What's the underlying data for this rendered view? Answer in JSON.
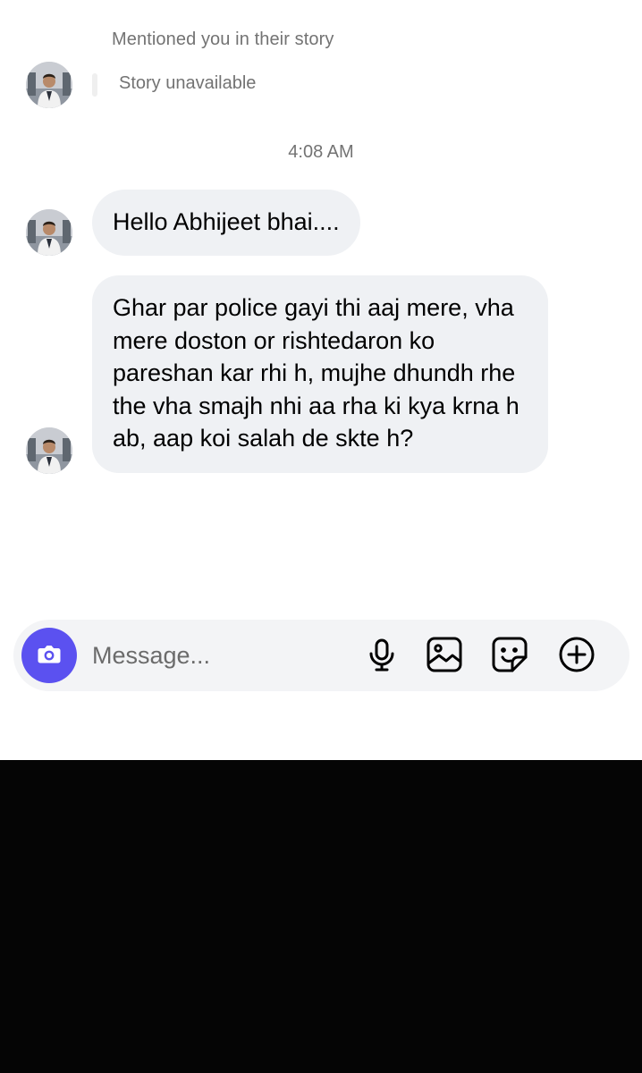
{
  "story": {
    "mention_text": "Mentioned you in their story",
    "unavailable_text": "Story unavailable"
  },
  "thread": {
    "timestamp": "4:08 AM",
    "messages": [
      {
        "text": "Hello Abhijeet bhai...."
      },
      {
        "text": "Ghar par police gayi thi aaj mere, vha mere doston or rishtedaron ko pareshan kar rhi h, mujhe dhundh rhe the vha smajh nhi aa rha ki kya krna h ab, aap koi salah de skte h?"
      }
    ]
  },
  "composer": {
    "placeholder": "Message...",
    "value": "",
    "icons": {
      "camera": "camera-icon",
      "mic": "microphone-icon",
      "gallery": "gallery-icon",
      "sticker": "sticker-icon",
      "more": "plus-circle-icon"
    }
  },
  "colors": {
    "accent": "#5b51f0",
    "incoming_bubble": "#eff1f4",
    "secondary_text": "#737373",
    "composer_bg": "#f3f4f6",
    "bottom_panel": "#050505"
  }
}
